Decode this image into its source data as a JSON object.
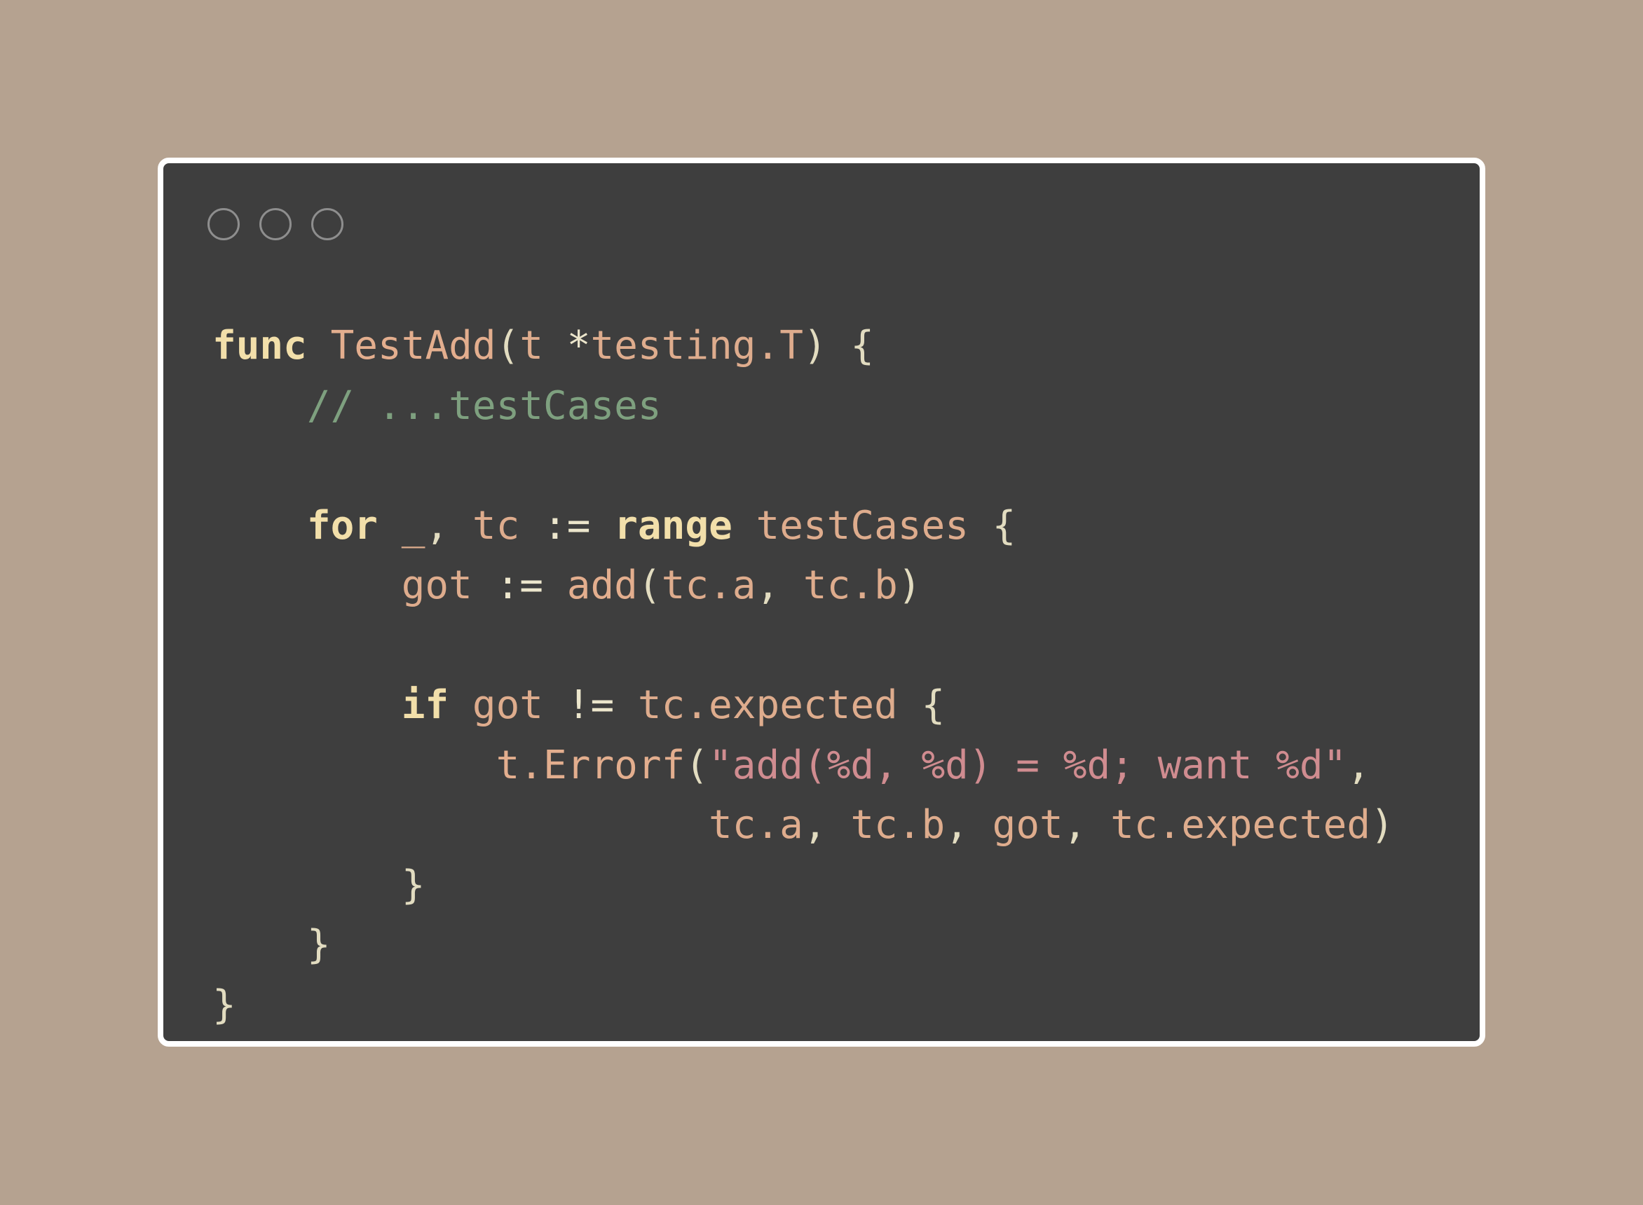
{
  "window": {
    "controls": [
      "close",
      "minimize",
      "maximize"
    ]
  },
  "code": {
    "l1": {
      "kw": "func",
      "fn": "TestAdd",
      "p1": "(",
      "a1": "t",
      "op": "*",
      "a2": "testing.T",
      "p2": ") {"
    },
    "l2": {
      "comment": "// ...testCases"
    },
    "l4": {
      "kw1": "for",
      "a1": "_",
      "p1": ",",
      "a2": "tc",
      "op": ":=",
      "kw2": "range",
      "a3": "testCases",
      "p2": "{"
    },
    "l5": {
      "a1": "got",
      "op": ":=",
      "fn": "add",
      "p1": "(",
      "a2": "tc.a",
      "p2": ",",
      "a3": "tc.b",
      "p3": ")"
    },
    "l7": {
      "kw": "if",
      "a1": "got",
      "op": "!=",
      "a2": "tc.expected",
      "p1": "{"
    },
    "l8": {
      "fn": "t.Errorf",
      "p1": "(",
      "str": "\"add(%d, %d) = %d; want %d\"",
      "p2": ","
    },
    "l9": {
      "a1": "tc.a",
      "p1": ",",
      "a2": "tc.b",
      "p2": ",",
      "a3": "got",
      "p3": ",",
      "a4": "tc.expected",
      "p4": ")"
    },
    "l10": {
      "p": "}"
    },
    "l11": {
      "p": "}"
    },
    "l12": {
      "p": "}"
    }
  },
  "colors": {
    "background": "#b5a290",
    "window": "#3e3e3e",
    "keyword": "#f2dfaa",
    "identifier": "#deac8d",
    "comment": "#7ea07f",
    "string": "#d08c90"
  }
}
